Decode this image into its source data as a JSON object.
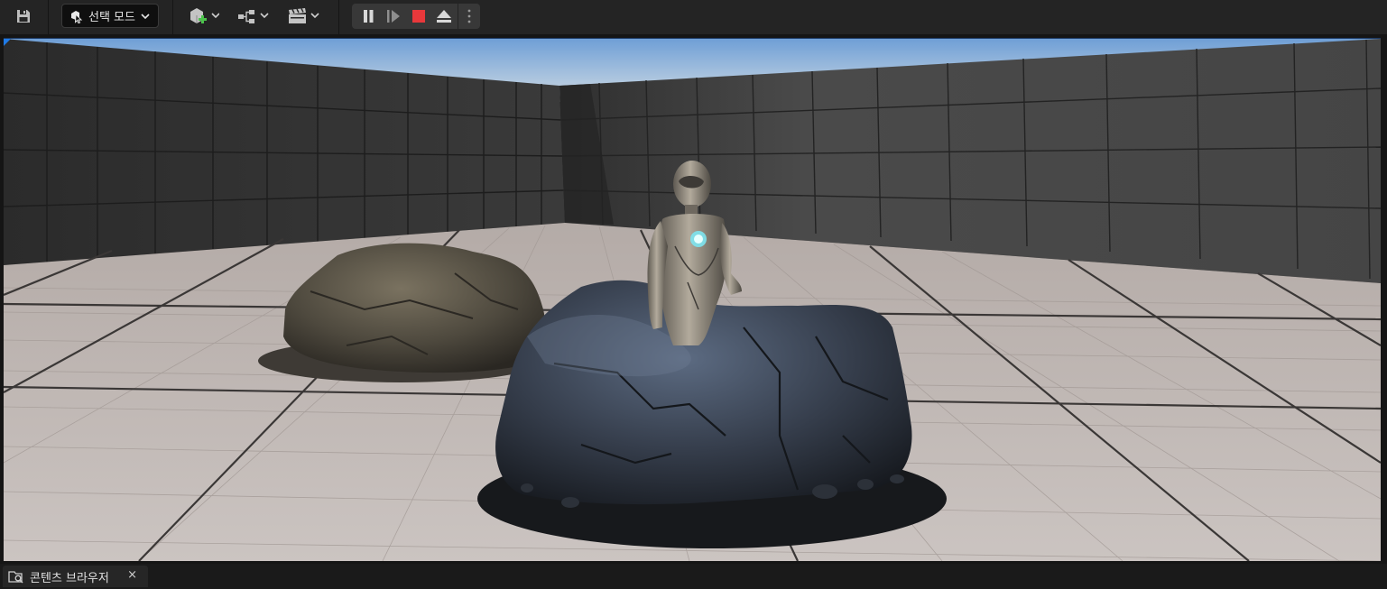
{
  "toolbar": {
    "mode_label": "선택 모드",
    "icons": [
      "save-icon",
      "selection-mode-icon",
      "add-actor-icon",
      "blueprint-icon",
      "cinematics-icon"
    ],
    "play_controls": [
      "pause-icon",
      "step-frame-icon",
      "stop-icon",
      "eject-icon",
      "more-options-icon"
    ],
    "colors": {
      "stop": "#e8383b",
      "bar": "#242424",
      "accent": "#1f7ae6"
    }
  },
  "viewport": {
    "scene": [
      "grid-wall-left",
      "grid-wall-right",
      "tiled-floor",
      "sky",
      "rock-small",
      "rock-large",
      "robot-mannequin"
    ]
  },
  "bottom": {
    "tab_label": "콘텐츠 브라우저",
    "close_glyph": "×"
  }
}
